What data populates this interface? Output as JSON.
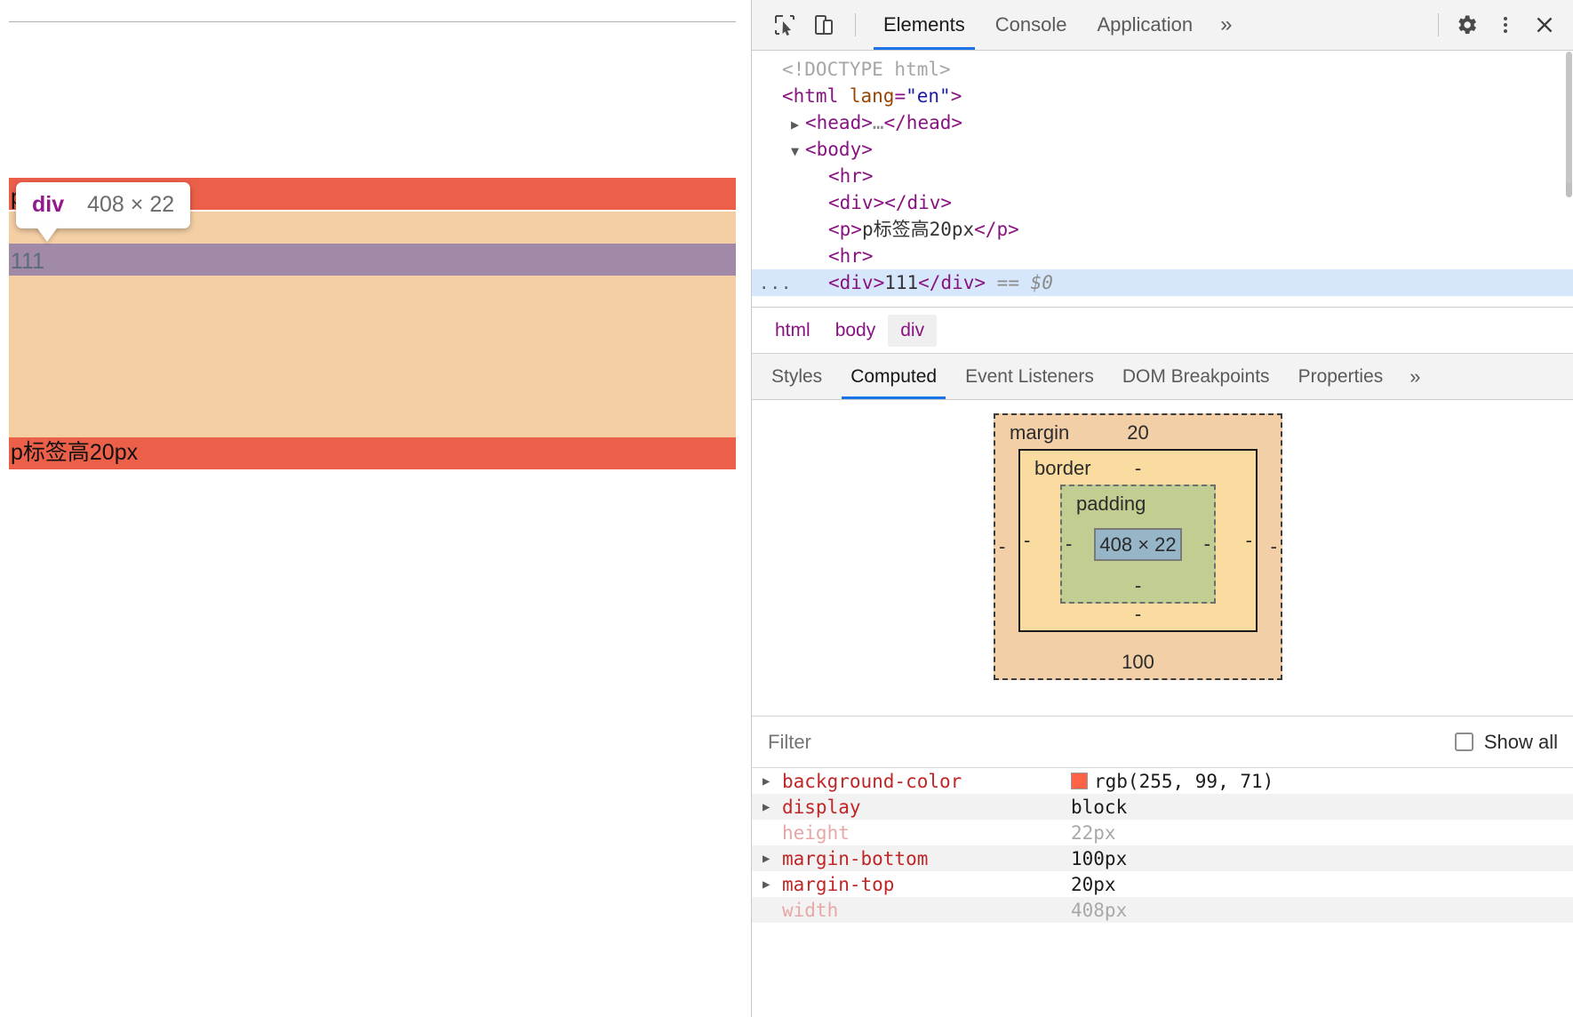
{
  "page": {
    "inspector_tooltip": {
      "tag": "div",
      "dimensions": "408 × 22"
    },
    "paragraph_top_text": "p标签高20px",
    "content_text": "111",
    "paragraph_bottom_text": "p标签高20px"
  },
  "devtools": {
    "toolbar": {
      "inspect_icon": "inspect-cursor-icon",
      "device_icon": "device-toolbar-icon",
      "tabs": [
        {
          "label": "Elements",
          "active": true
        },
        {
          "label": "Console",
          "active": false
        },
        {
          "label": "Application",
          "active": false
        }
      ],
      "more_tabs": "»",
      "settings_icon": "gear-icon",
      "menu_icon": "kebab-menu-icon",
      "close_icon": "close-icon"
    },
    "dom": {
      "lines": [
        {
          "indent": 0,
          "twisty": "",
          "html": "<span class=\"tok-doctype\">&lt;!DOCTYPE html&gt;</span>"
        },
        {
          "indent": 0,
          "twisty": "",
          "html": "<span class=\"tok-tag\">&lt;html</span> <span class=\"tok-attr\">lang</span><span class=\"tok-tag\">=</span><span class=\"tok-val\">\"en\"</span><span class=\"tok-tag\">&gt;</span>"
        },
        {
          "indent": 1,
          "twisty": "▶",
          "html": "<span class=\"tok-tag\">&lt;head&gt;</span><span class=\"tok-gray\">…</span><span class=\"tok-tag\">&lt;/head&gt;</span>"
        },
        {
          "indent": 1,
          "twisty": "▼",
          "html": "<span class=\"tok-tag\">&lt;body&gt;</span>"
        },
        {
          "indent": 2,
          "twisty": "",
          "html": "<span class=\"tok-tag\">&lt;hr&gt;</span>"
        },
        {
          "indent": 2,
          "twisty": "",
          "html": "<span class=\"tok-tag\">&lt;div&gt;&lt;/div&gt;</span>"
        },
        {
          "indent": 2,
          "twisty": "",
          "html": "<span class=\"tok-tag\">&lt;p&gt;</span><span class=\"tok-text\">p标签高20px</span><span class=\"tok-tag\">&lt;/p&gt;</span>"
        },
        {
          "indent": 2,
          "twisty": "",
          "html": "<span class=\"tok-tag\">&lt;hr&gt;</span>"
        },
        {
          "indent": 2,
          "twisty": "",
          "selected": true,
          "badge": "···",
          "html": "<span class=\"tok-tag\">&lt;div&gt;</span><span class=\"tok-text\">111</span><span class=\"tok-tag\">&lt;/div&gt;</span> <span class=\"tok-gray\">==</span> <span class=\"tok-dollar\">$0</span>"
        }
      ]
    },
    "breadcrumb": [
      {
        "label": "html",
        "active": false
      },
      {
        "label": "body",
        "active": false
      },
      {
        "label": "div",
        "active": true
      }
    ],
    "sidebar_tabs": [
      {
        "label": "Styles",
        "active": false
      },
      {
        "label": "Computed",
        "active": true
      },
      {
        "label": "Event Listeners",
        "active": false
      },
      {
        "label": "DOM Breakpoints",
        "active": false
      },
      {
        "label": "Properties",
        "active": false
      }
    ],
    "sidebar_more": "»",
    "box_model": {
      "margin_label": "margin",
      "margin_top": "20",
      "margin_right": "-",
      "margin_bottom": "100",
      "margin_left": "-",
      "border_label": "border",
      "border_top": "-",
      "border_right": "-",
      "border_bottom": "-",
      "border_left": "-",
      "padding_label": "padding",
      "padding_top": "",
      "padding_right": "-",
      "padding_bottom": "-",
      "padding_left": "-",
      "content_dimensions": "408 × 22",
      "colors": {
        "margin": "#f3cfa8",
        "border": "#fadca0",
        "padding": "#c2cd92",
        "content": "#96b5c7"
      }
    },
    "filter": {
      "placeholder": "Filter",
      "value": "",
      "show_all_label": "Show all",
      "show_all_checked": false
    },
    "computed_properties": [
      {
        "name": "background-color",
        "value": "rgb(255, 99, 71)",
        "swatch": "#ff6347",
        "expandable": true,
        "inherited": false
      },
      {
        "name": "display",
        "value": "block",
        "swatch": "",
        "expandable": true,
        "inherited": false
      },
      {
        "name": "height",
        "value": "22px",
        "swatch": "",
        "expandable": false,
        "inherited": true
      },
      {
        "name": "margin-bottom",
        "value": "100px",
        "swatch": "",
        "expandable": true,
        "inherited": false
      },
      {
        "name": "margin-top",
        "value": "20px",
        "swatch": "",
        "expandable": true,
        "inherited": false
      },
      {
        "name": "width",
        "value": "408px",
        "swatch": "",
        "expandable": false,
        "inherited": true
      }
    ]
  }
}
